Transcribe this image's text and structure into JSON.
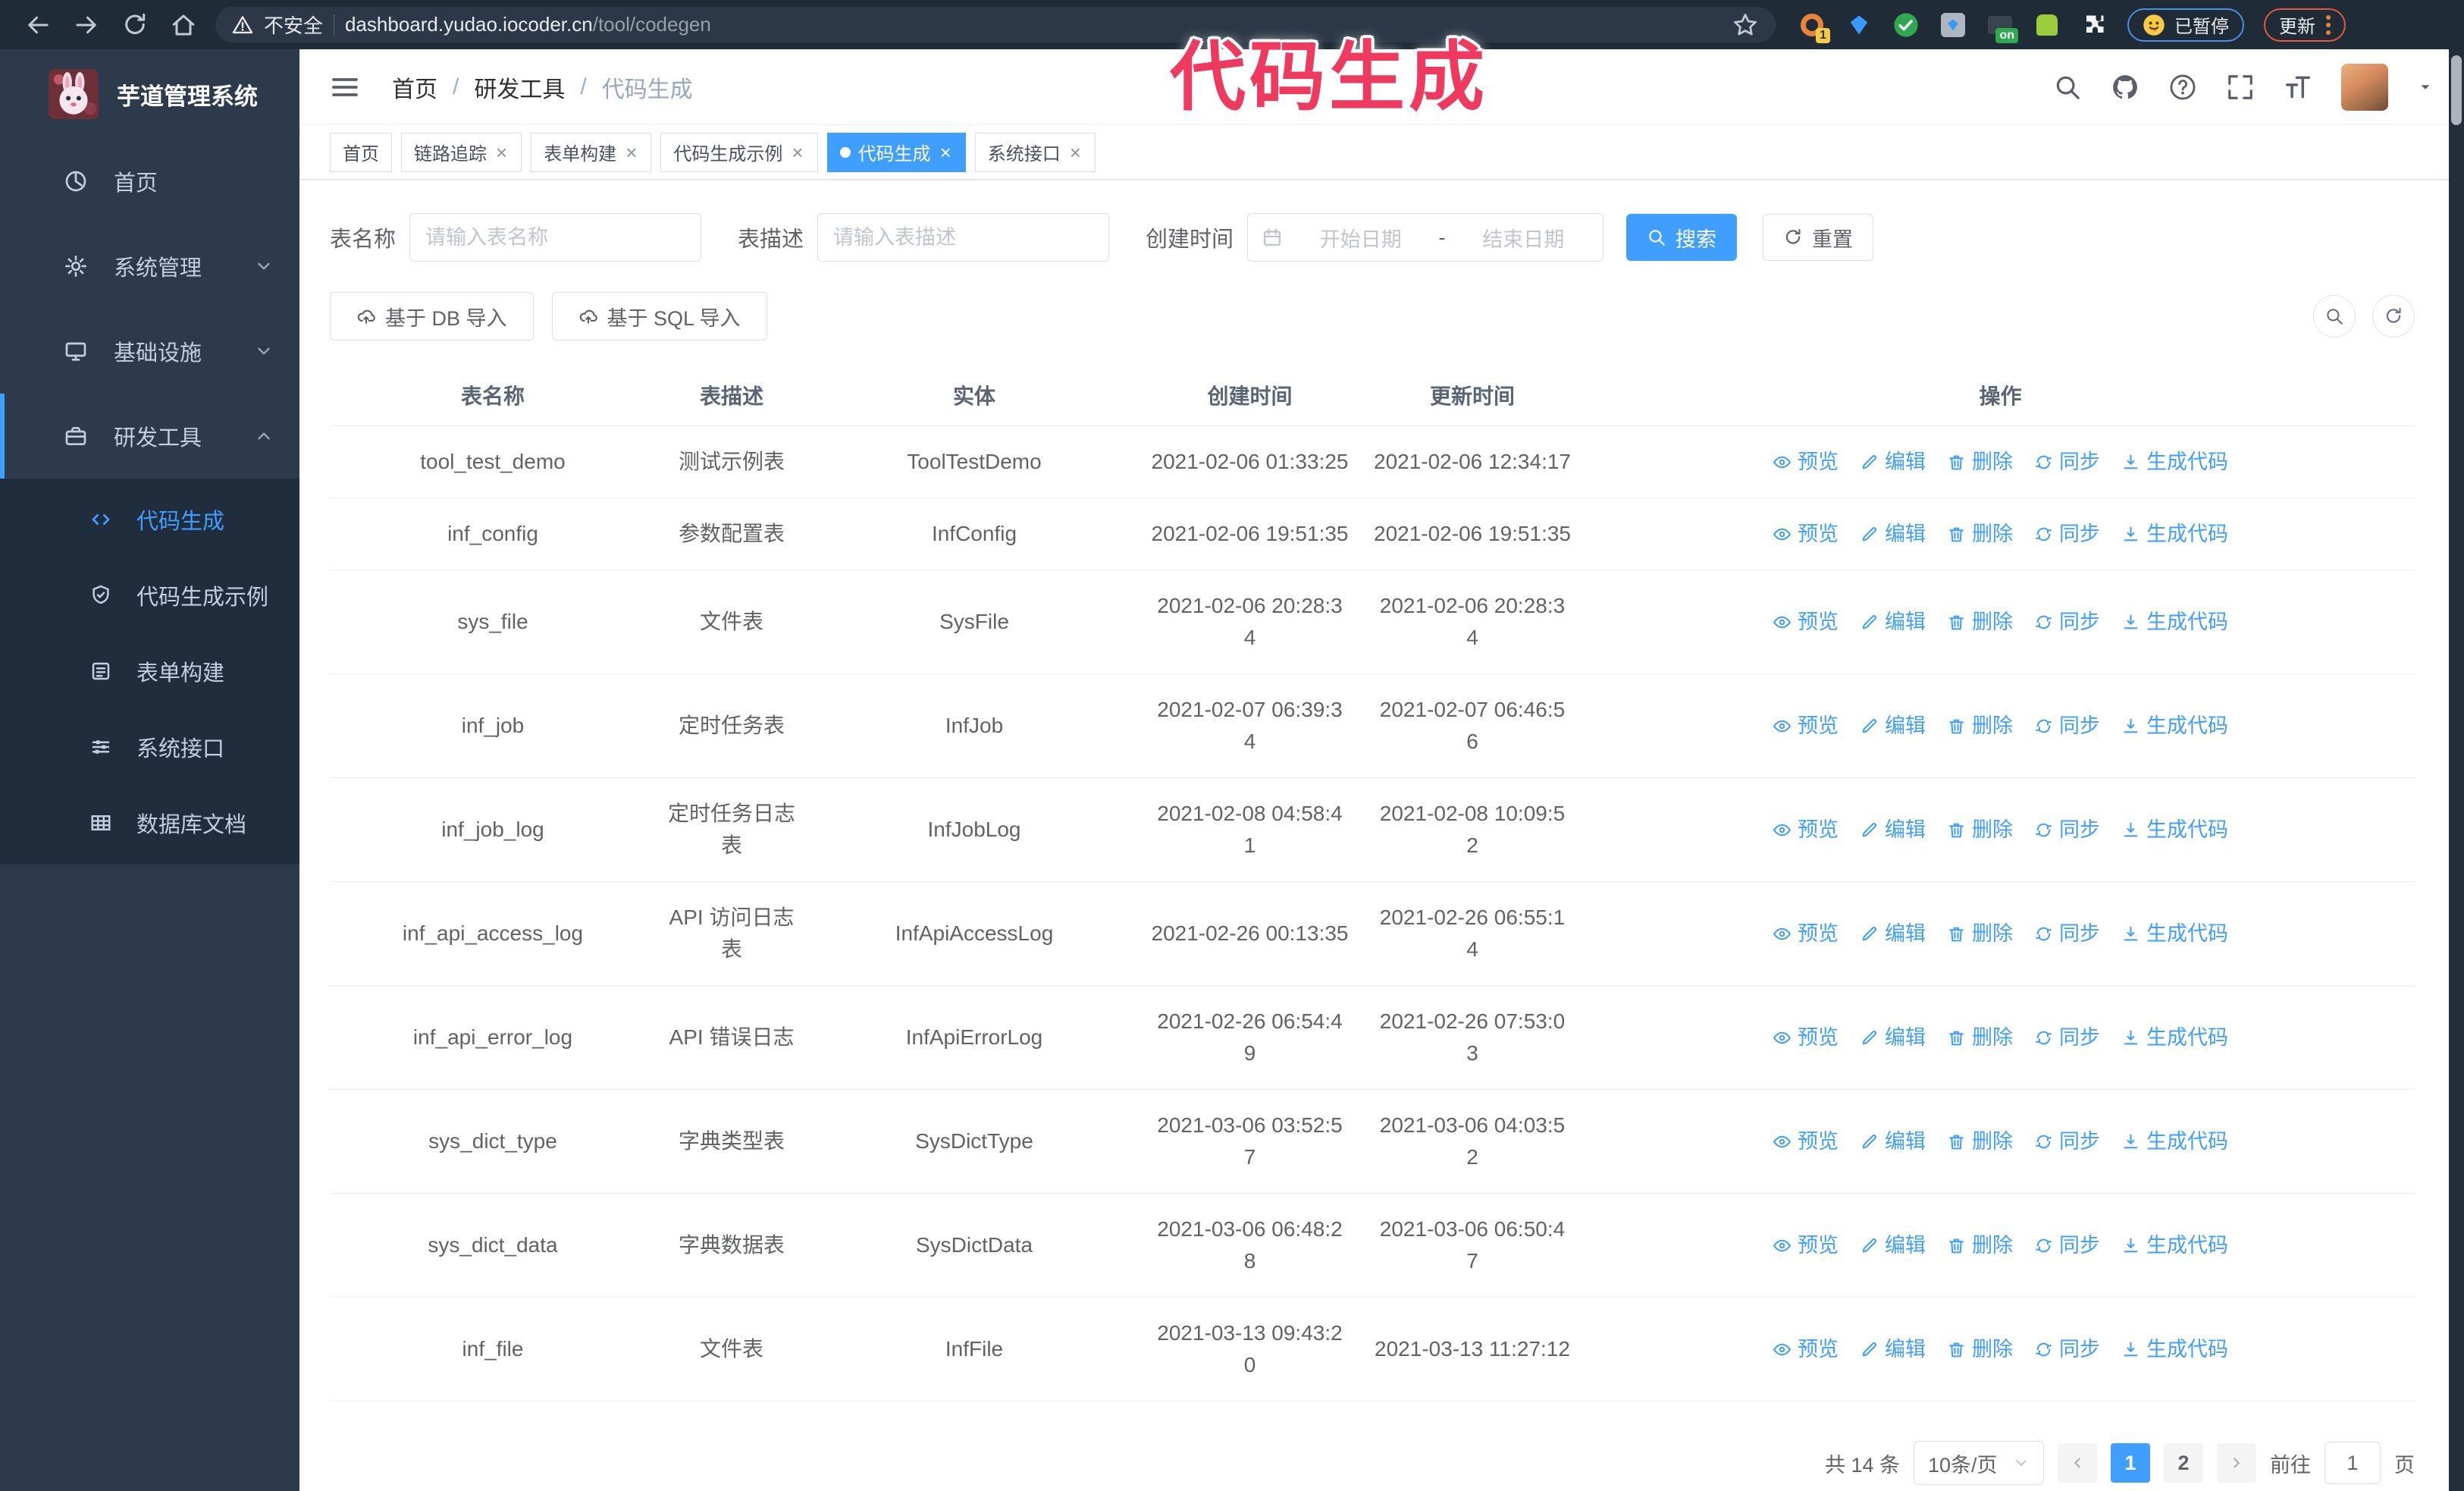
{
  "browser": {
    "security_label": "不安全",
    "url_host": "dashboard.yudao.iocoder.cn",
    "url_path": "/tool/codegen",
    "extension_badge": "1",
    "extension_on_badge": "on",
    "paused_badge": "已暂停",
    "update_badge": "更新"
  },
  "overlay": {
    "title": "代码生成"
  },
  "sidebar": {
    "app_title": "芋道管理系统",
    "menu": [
      {
        "label": "首页"
      },
      {
        "label": "系统管理"
      },
      {
        "label": "基础设施"
      },
      {
        "label": "研发工具"
      }
    ],
    "submenu": [
      {
        "label": "代码生成",
        "active": true
      },
      {
        "label": "代码生成示例"
      },
      {
        "label": "表单构建"
      },
      {
        "label": "系统接口"
      },
      {
        "label": "数据库文档"
      }
    ]
  },
  "header": {
    "breadcrumb": [
      "首页",
      "研发工具",
      "代码生成"
    ],
    "separator": "/"
  },
  "tabs": [
    {
      "label": "首页",
      "closable": false
    },
    {
      "label": "链路追踪",
      "closable": true
    },
    {
      "label": "表单构建",
      "closable": true
    },
    {
      "label": "代码生成示例",
      "closable": true
    },
    {
      "label": "代码生成",
      "closable": true,
      "active": true
    },
    {
      "label": "系统接口",
      "closable": true
    }
  ],
  "filters": {
    "table_name_label": "表名称",
    "table_name_placeholder": "请输入表名称",
    "table_desc_label": "表描述",
    "table_desc_placeholder": "请输入表描述",
    "create_time_label": "创建时间",
    "date_start_placeholder": "开始日期",
    "date_separator": "-",
    "date_end_placeholder": "结束日期",
    "search_button": "搜索",
    "reset_button": "重置"
  },
  "toolbar": {
    "import_db_label": "基于 DB 导入",
    "import_sql_label": "基于 SQL 导入"
  },
  "table": {
    "columns": [
      "表名称",
      "表描述",
      "实体",
      "创建时间",
      "更新时间",
      "操作"
    ],
    "actions": [
      "预览",
      "编辑",
      "删除",
      "同步",
      "生成代码"
    ],
    "rows": [
      {
        "name": "tool_test_demo",
        "desc": "测试示例表",
        "entity": "ToolTestDemo",
        "created": "2021-02-06 01:33:25",
        "updated": "2021-02-06 12:34:17"
      },
      {
        "name": "inf_config",
        "desc": "参数配置表",
        "entity": "InfConfig",
        "created": "2021-02-06 19:51:35",
        "updated": "2021-02-06 19:51:35"
      },
      {
        "name": "sys_file",
        "desc": "文件表",
        "entity": "SysFile",
        "created": "2021-02-06 20:28:3\n4",
        "updated": "2021-02-06 20:28:3\n4"
      },
      {
        "name": "inf_job",
        "desc": "定时任务表",
        "entity": "InfJob",
        "created": "2021-02-07 06:39:3\n4",
        "updated": "2021-02-07 06:46:5\n6"
      },
      {
        "name": "inf_job_log",
        "desc": "定时任务日志表",
        "entity": "InfJobLog",
        "created": "2021-02-08 04:58:4\n1",
        "updated": "2021-02-08 10:09:5\n2"
      },
      {
        "name": "inf_api_access_log",
        "desc": "API 访问日志表",
        "entity": "InfApiAccessLog",
        "created": "2021-02-26 00:13:35",
        "updated": "2021-02-26 06:55:1\n4"
      },
      {
        "name": "inf_api_error_log",
        "desc": "API 错误日志",
        "entity": "InfApiErrorLog",
        "created": "2021-02-26 06:54:4\n9",
        "updated": "2021-02-26 07:53:0\n3"
      },
      {
        "name": "sys_dict_type",
        "desc": "字典类型表",
        "entity": "SysDictType",
        "created": "2021-03-06 03:52:5\n7",
        "updated": "2021-03-06 04:03:5\n2"
      },
      {
        "name": "sys_dict_data",
        "desc": "字典数据表",
        "entity": "SysDictData",
        "created": "2021-03-06 06:48:2\n8",
        "updated": "2021-03-06 06:50:4\n7"
      },
      {
        "name": "inf_file",
        "desc": "文件表",
        "entity": "InfFile",
        "created": "2021-03-13 09:43:2\n0",
        "updated": "2021-03-13 11:27:12"
      }
    ]
  },
  "pagination": {
    "total_label": "共 14 条",
    "page_size_label": "10条/页",
    "page_1": "1",
    "page_2": "2",
    "goto_label": "前往",
    "goto_value": "1",
    "page_unit": "页"
  },
  "colors": {
    "accent": "#409eff",
    "pink": "#ee3a5e",
    "chrome-bg": "#202b38",
    "sidebar-bg": "#2d3a4b",
    "submenu-bg": "#1f2d3d",
    "border": "#dcdfe6"
  }
}
